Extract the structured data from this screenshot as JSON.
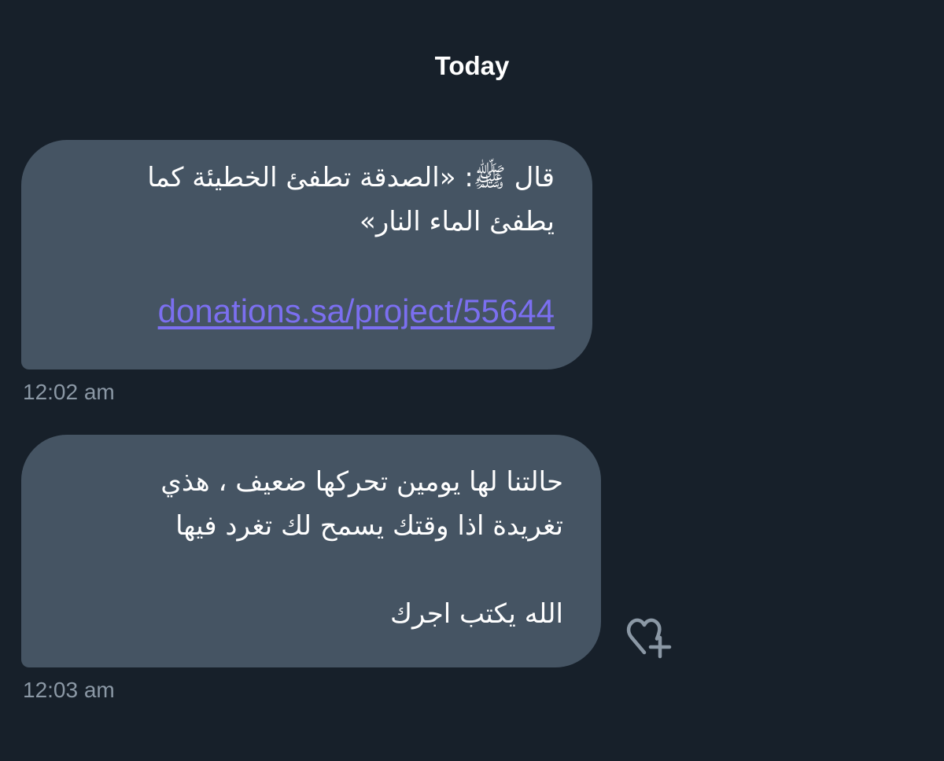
{
  "conversation": {
    "date_label": "Today",
    "messages": [
      {
        "lines": [
          "قال ﷺ: «الصدقة تطفئ الخطيئة كما",
          "يطفئ الماء النار»"
        ],
        "link": "donations.sa/project/55644",
        "time": "12:02 am"
      },
      {
        "lines": [
          "حالتنا لها يومين تحركها ضعيف ، هذي",
          "تغريدة اذا وقتك يسمح لك تغرد فيها"
        ],
        "closing": "الله يكتب اجرك",
        "time": "12:03 am"
      }
    ],
    "react_icon": "heart-plus-icon",
    "colors": {
      "background": "#17202a",
      "bubble": "#455463",
      "link": "#7b6ff0",
      "timestamp": "#8b98a5"
    }
  }
}
